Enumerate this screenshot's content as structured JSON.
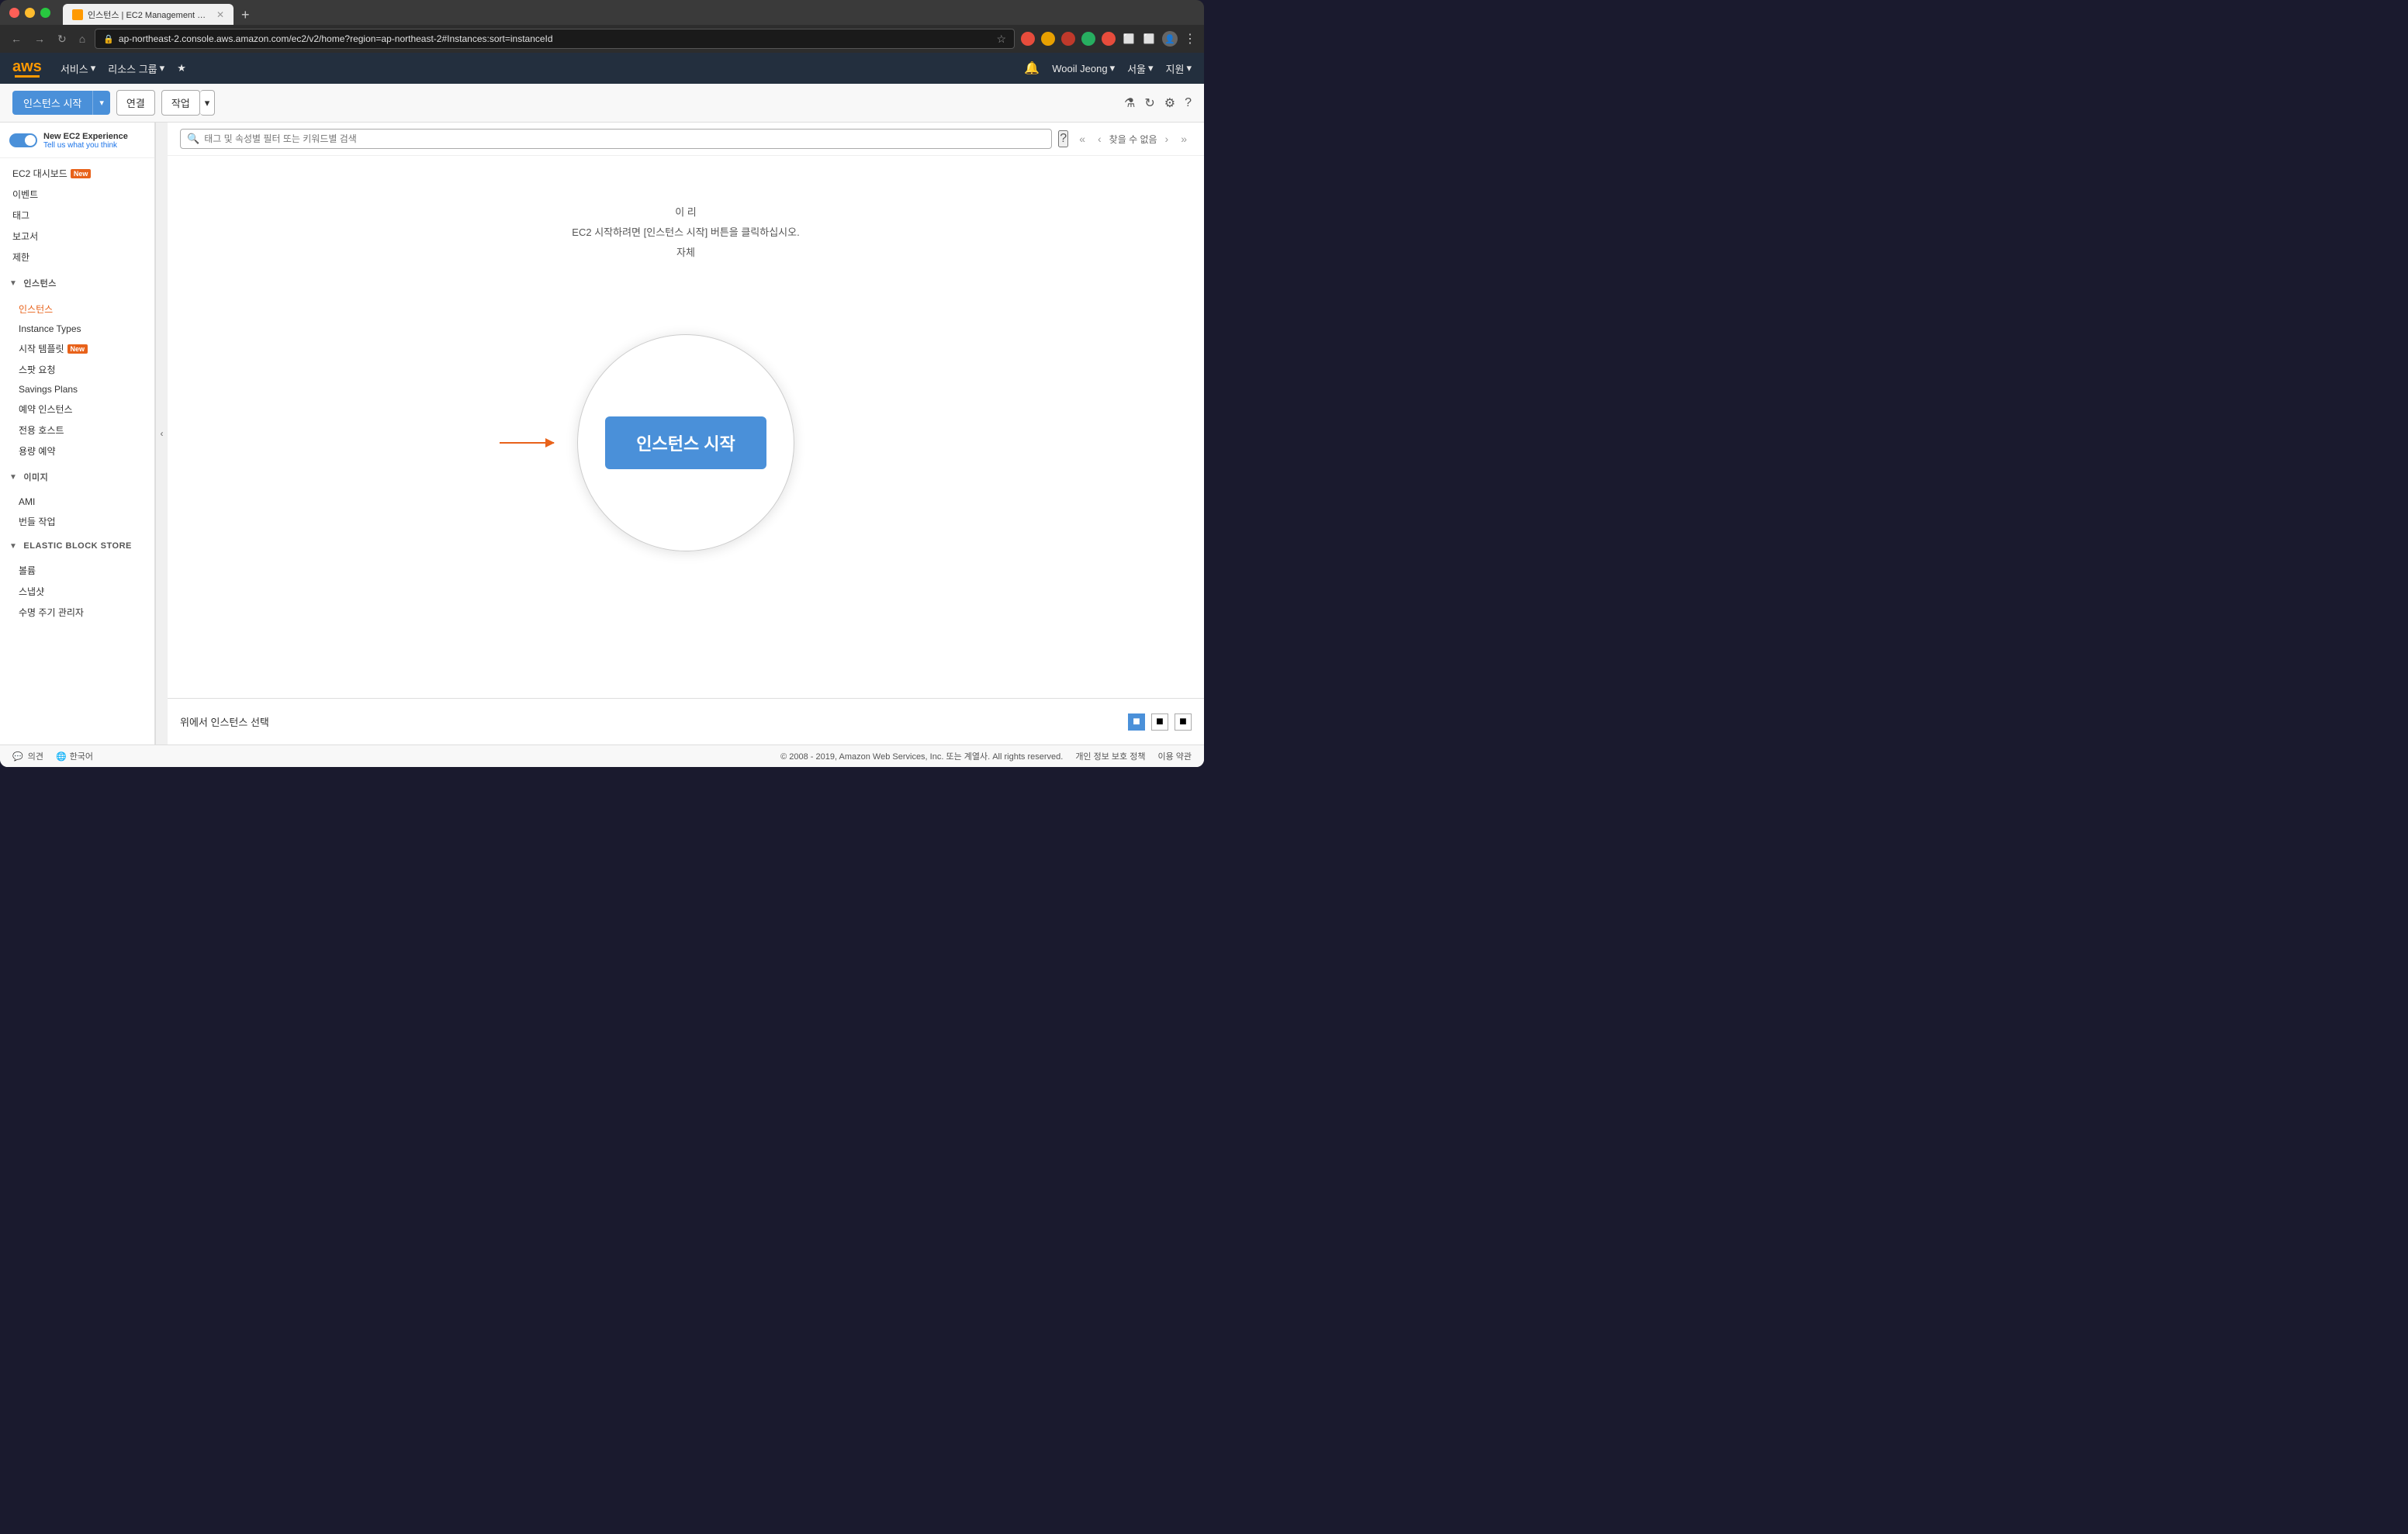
{
  "browser": {
    "tab_title": "인스턴스 | EC2 Management Co...",
    "tab_new": "+",
    "url": "ap-northeast-2.console.aws.amazon.com/ec2/v2/home?region=ap-northeast-2#Instances:sort=instanceId",
    "nav_back": "←",
    "nav_forward": "→",
    "nav_refresh": "↻",
    "nav_home": "⌂"
  },
  "aws_nav": {
    "logo_text": "aws",
    "services_label": "서비스",
    "resources_label": "리소스 그룹",
    "services_arrow": "▾",
    "resources_arrow": "▾",
    "bookmark_icon": "★",
    "bell_icon": "🔔",
    "user_name": "Wooil Jeong",
    "user_arrow": "▾",
    "region": "서울",
    "region_arrow": "▾",
    "support": "지원",
    "support_arrow": "▾"
  },
  "toolbar": {
    "launch_btn": "인스턴스 시작",
    "launch_arrow": "▾",
    "connect_btn": "연결",
    "actions_btn": "작업",
    "actions_arrow": "▾",
    "flask_icon": "⚗",
    "refresh_icon": "↻",
    "settings_icon": "⚙",
    "help_icon": "?"
  },
  "search": {
    "placeholder": "태그 및 속성별 필터 또는 키워드별 검색",
    "help_icon": "?",
    "no_results": "찾을 수 없음",
    "prev_icon": "‹",
    "next_icon": "›",
    "first_icon": "«",
    "last_icon": "»"
  },
  "sidebar": {
    "toggle_label": "New EC2 Experience",
    "toggle_sublabel": "Tell us what you think",
    "items": [
      {
        "id": "ec2-dashboard",
        "label": "EC2 대시보드",
        "badge": "New",
        "level": 0
      },
      {
        "id": "events",
        "label": "이벤트",
        "badge": null,
        "level": 0
      },
      {
        "id": "tags",
        "label": "태그",
        "badge": null,
        "level": 0
      },
      {
        "id": "reports",
        "label": "보고서",
        "badge": null,
        "level": 0
      },
      {
        "id": "limits",
        "label": "제한",
        "badge": null,
        "level": 0
      },
      {
        "id": "instances-section",
        "label": "인스턴스",
        "type": "section",
        "collapsed": false
      },
      {
        "id": "instances",
        "label": "인스턴스",
        "badge": null,
        "active": true,
        "level": 1
      },
      {
        "id": "instance-types",
        "label": "Instance Types",
        "badge": null,
        "level": 1
      },
      {
        "id": "launch-templates",
        "label": "시작 템플릿",
        "badge": "New",
        "level": 1
      },
      {
        "id": "spot-requests",
        "label": "스팟 요청",
        "badge": null,
        "level": 1
      },
      {
        "id": "savings-plans",
        "label": "Savings Plans",
        "badge": null,
        "level": 1
      },
      {
        "id": "reserved-instances",
        "label": "예약 인스턴스",
        "badge": null,
        "level": 1
      },
      {
        "id": "dedicated-hosts",
        "label": "전용 호스트",
        "badge": null,
        "level": 1
      },
      {
        "id": "capacity-reservations",
        "label": "용량 예약",
        "badge": null,
        "level": 1
      },
      {
        "id": "images-section",
        "label": "이미지",
        "type": "section",
        "collapsed": false
      },
      {
        "id": "ami",
        "label": "AMI",
        "badge": null,
        "level": 1
      },
      {
        "id": "bundle-tasks",
        "label": "번들 작업",
        "badge": null,
        "level": 1
      },
      {
        "id": "ebs-section",
        "label": "ELASTIC BLOCK STORE",
        "type": "section",
        "collapsed": false
      },
      {
        "id": "volumes",
        "label": "볼륨",
        "badge": null,
        "level": 1
      },
      {
        "id": "snapshots",
        "label": "스냅샷",
        "badge": null,
        "level": 1
      },
      {
        "id": "lifecycle-manager",
        "label": "수명 주기 관리자",
        "badge": null,
        "level": 1
      }
    ]
  },
  "main_content": {
    "empty_line1": "이 리",
    "empty_line2": "EC2 시작하려면 [인스턴스 시작] 버튼을 클릭하십시오.",
    "empty_line3": "자체",
    "launch_btn_circle": "인스턴스 시작"
  },
  "bottom_panel": {
    "select_instance_text": "위에서 인스턴스 선택"
  },
  "footer": {
    "feedback_icon": "💬",
    "feedback_label": "의견",
    "lang_icon": "🌐",
    "lang_label": "한국어",
    "copyright": "© 2008 - 2019, Amazon Web Services, Inc. 또는 계열사. All rights reserved.",
    "privacy_link": "개인 정보 보호 정책",
    "terms_link": "이용 약관"
  }
}
